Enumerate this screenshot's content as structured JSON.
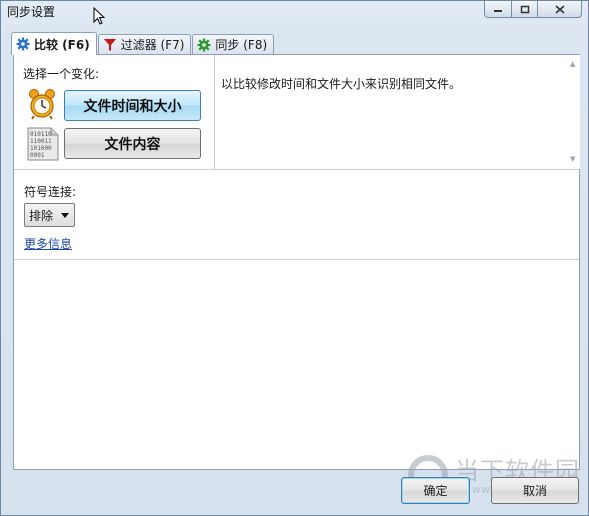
{
  "window": {
    "title": "同步设置"
  },
  "tabs": [
    {
      "label": "比较 (F6)",
      "icon": "gear-blue-icon",
      "active": true
    },
    {
      "label": "过滤器 (F7)",
      "icon": "filter-red-icon",
      "active": false
    },
    {
      "label": "同步 (F8)",
      "icon": "gear-green-icon",
      "active": false
    }
  ],
  "compare": {
    "choose_label": "选择一个变化:",
    "options": [
      {
        "label": "文件时间和大小",
        "icon": "alarm-clock-icon",
        "selected": true
      },
      {
        "label": "文件内容",
        "icon": "binary-file-icon",
        "selected": false
      }
    ],
    "description": "以比较修改时间和文件大小来识别相同文件。",
    "binary_icon_text": "010110 110011 101000 0001"
  },
  "symlinks": {
    "label": "符号连接:",
    "selected": "排除",
    "more_info": "更多信息"
  },
  "buttons": {
    "ok": "确定",
    "cancel": "取消"
  },
  "watermark": {
    "text": "当下软件园",
    "url": "www.downxia.com"
  }
}
